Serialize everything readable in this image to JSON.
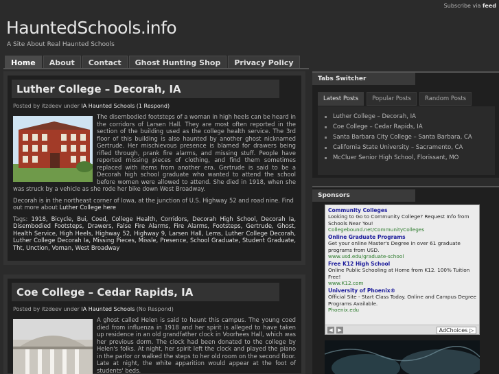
{
  "topbar": {
    "text": "Subscribe via",
    "feed": "feed"
  },
  "site": {
    "title": "HauntedSchools.info",
    "tagline": "A Site About Real Haunted Schools"
  },
  "nav": [
    "Home",
    "About",
    "Contact",
    "Ghost Hunting Shop",
    "Privacy Policy"
  ],
  "posts": [
    {
      "title": "Luther College – Decorah, IA",
      "meta_prefix": "Posted by",
      "author": "itzdeev",
      "meta_under": "under",
      "category": "IA Haunted Schools",
      "responses": "(1 Respond)",
      "body": "The disembodied footsteps of a woman in high heels can be heard in the corridors of Larsen Hall. They are most often reported in the section of the building used as the college health service. The 3rd floor of this building is also haunted by another ghost nicknamed Gertrude. Her mischievous presence is blamed for drawers being rifled through, prank fire alarms, and missing stuff. People have reported missing pieces of clothing, and find them sometimes replaced with items from another era. Gertrude is said to be a Decorah high school graduate who wanted to attend the school before women were allowed to attend. She died in 1918, when she was struck by a vehicle as she rode her bike down West Broadway.",
      "para2": "Decorah is in the northeast corner of Iowa, at the junction of U.S. Highway 52 and road nine. Find out more about",
      "para2_link": "Luther College here",
      "tags_label": "Tags:",
      "tags": "1918, Bicycle, Bui, Coed, College Health, Corridors, Decorah High School, Decorah Ia, Disembodied Footsteps, Drawers, False Fire Alarms, Fire Alarms, Footsteps, Gertrude, Ghost, Health Service, High Heels, Highway 52, Highway 9, Larsen Hall, Lems, Luther College Decorah, Luther College Decorah Ia, Missing Pieces, Missle, Presence, School Graduate, Student Graduate, Tht, Unction, Voman, West Broadway"
    },
    {
      "title": "Coe College – Cedar Rapids, IA",
      "meta_prefix": "Posted by",
      "author": "itzdeev",
      "meta_under": "under",
      "category": "IA Haunted Schools",
      "responses": "(No Respond)",
      "body": "A ghost called Helen is said to haunt this campus. The young coed died from influenza in 1918 and her spirit is alleged to have taken up residence in an old grandfather clock in Voorhees Hall, which was her previous dorm. The clock had been donated to the college by Helen's folks. At night, her spirit left the clock and played the piano in the parlor or walked the steps to her old room on the second floor. Late at night, the white apparition would appear at the foot of students' beds."
    }
  ],
  "sidebar": {
    "tabs_title": "Tabs Switcher",
    "tabs": [
      "Latest Posts",
      "Popular Posts",
      "Random Posts"
    ],
    "latest": [
      "Luther College – Decorah, IA",
      "Coe College – Cedar Rapids, IA",
      "Santa Barbara City College – Santa Barbara, CA",
      "California State University – Sacramento, CA",
      "McCluer Senior High School, Florissant, MO"
    ],
    "sponsors_title": "Sponsors",
    "ads": [
      {
        "h": "Community Colleges",
        "d": "Looking to Go to Community College? Request Info from Schools Near You!",
        "u": "Collegebound.net/CommunityColleges"
      },
      {
        "h": "Online Graduate Programs",
        "d": "Get your online Master's Degree in over 61 graduate programs from USD.",
        "u": "www.usd.edu/graduate-school"
      },
      {
        "h": "Free K12 High School",
        "d": "Online Public Schooling at Home from K12. 100% Tuition Free!",
        "u": "www.K12.com"
      },
      {
        "h": "University of Phoenix®",
        "d": "Official Site - Start Class Today. Online and Campus Degree Programs Available.",
        "u": "Phoenix.edu"
      }
    ],
    "adchoices": "AdChoices ▷"
  }
}
